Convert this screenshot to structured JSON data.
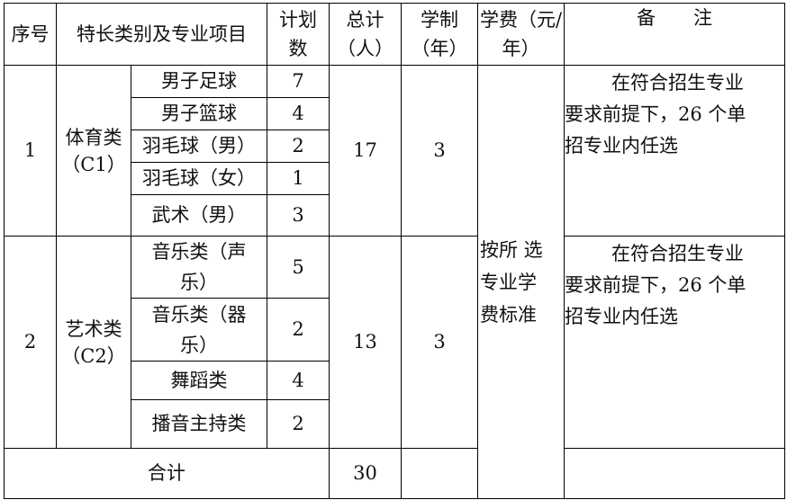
{
  "headers": {
    "seq": "序号",
    "category": "特长类别及专业项目",
    "plan": "计划数",
    "total": "总计（人）",
    "duration": "学制（年）",
    "fee": "学费（元/年）",
    "note": "备　　注"
  },
  "groups": [
    {
      "seq": "1",
      "category_name": "体育类",
      "category_code": "（C1）",
      "total": "17",
      "duration": "3",
      "note_line1": "在符合招生专业",
      "note_line2": "要求前提下，26 个单",
      "note_line3": "招专业内任选",
      "items": [
        {
          "name": "男子足球",
          "plan": "7"
        },
        {
          "name": "男子篮球",
          "plan": "4"
        },
        {
          "name": "羽毛球（男）",
          "plan": "2"
        },
        {
          "name": "羽毛球（女）",
          "plan": "1"
        },
        {
          "name": "武术（男）",
          "plan": "3"
        }
      ]
    },
    {
      "seq": "2",
      "category_name": "艺术类",
      "category_code": "（C2）",
      "total": "13",
      "duration": "3",
      "note_line1": "在符合招生专业",
      "note_line2": "要求前提下，26 个单",
      "note_line3": "招专业内任选",
      "items": [
        {
          "name": "音乐类（声乐）",
          "plan": "5"
        },
        {
          "name": "音乐类（器乐）",
          "plan": "2"
        },
        {
          "name": "舞蹈类",
          "plan": "4"
        },
        {
          "name": "播音主持类",
          "plan": "2"
        }
      ]
    }
  ],
  "fee_text_line1": "按所 选",
  "fee_text_line2": "专业学",
  "fee_text_line3": "费标准",
  "footer": {
    "label": "合计",
    "total": "30"
  }
}
